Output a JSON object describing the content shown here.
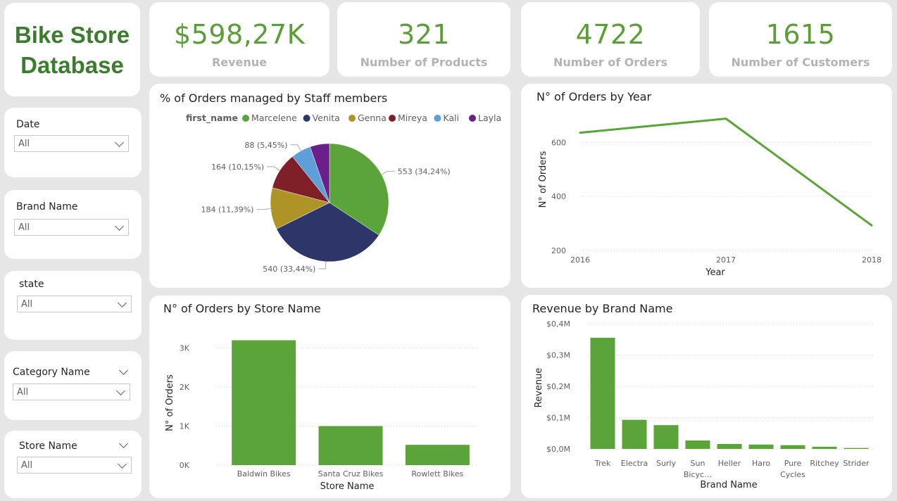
{
  "app": {
    "title_line1": "Bike Store",
    "title_line2": "Database"
  },
  "kpis": [
    {
      "value": "$598,27K",
      "label": "Revenue"
    },
    {
      "value": "321",
      "label": "Number of Products"
    },
    {
      "value": "4722",
      "label": "Number of Orders"
    },
    {
      "value": "1615",
      "label": "Number of Customers"
    }
  ],
  "slicers": {
    "date": {
      "label": "Date",
      "value": "All"
    },
    "brand": {
      "label": "Brand Name",
      "value": "All"
    },
    "state": {
      "label": "state",
      "value": "All"
    },
    "category": {
      "label": "Category Name",
      "value": "All"
    },
    "store": {
      "label": "Store Name",
      "value": "All"
    }
  },
  "colors": {
    "accent": "#5aa43a",
    "title_green": "#3a7d2c",
    "kpi_label": "#b3b3b3",
    "background": "#e6e6e6"
  },
  "chart_data": [
    {
      "type": "pie",
      "title": "% of Orders managed by Staff members",
      "legend_title": "first_name",
      "legend_position": "top",
      "slices": [
        {
          "name": "Marcelene",
          "value": 553,
          "label": "553 (34,24%)",
          "color": "#5aa43a"
        },
        {
          "name": "Venita",
          "value": 540,
          "label": "540 (33,44%)",
          "color": "#2e3568"
        },
        {
          "name": "Genna",
          "value": 184,
          "label": "184 (11,39%)",
          "color": "#ae9326"
        },
        {
          "name": "Mireya",
          "value": 164,
          "label": "164 (10,15%)",
          "color": "#7f1f28"
        },
        {
          "name": "Kali",
          "value": 88,
          "label": "88 (5,45%)",
          "color": "#5e9fd8"
        },
        {
          "name": "Layla",
          "value": 86,
          "label": "",
          "color": "#6b1f8a"
        }
      ]
    },
    {
      "type": "line",
      "title": "N° of Orders by Year",
      "xlabel": "Year",
      "ylabel": "N° of Orders",
      "x": [
        "2016",
        "2017",
        "2018"
      ],
      "values": [
        636,
        688,
        293
      ],
      "ylim": [
        200,
        700
      ],
      "yticks": [
        200,
        400,
        600
      ],
      "grid": true,
      "color": "#5aa43a"
    },
    {
      "type": "bar",
      "title": "N° of Orders by Store Name",
      "xlabel": "Store Name",
      "ylabel": "N° of Orders",
      "categories": [
        "Baldwin Bikes",
        "Santa Cruz Bikes",
        "Rowlett Bikes"
      ],
      "values": [
        3200,
        1000,
        520
      ],
      "ylim": [
        0,
        3300
      ],
      "yticks": [
        {
          "v": 0,
          "t": "0K"
        },
        {
          "v": 1000,
          "t": "1K"
        },
        {
          "v": 2000,
          "t": "2K"
        },
        {
          "v": 3000,
          "t": "3K"
        }
      ],
      "grid": true,
      "color": "#5aa43a"
    },
    {
      "type": "bar",
      "title": "Revenue by Brand Name",
      "xlabel": "Brand Name",
      "ylabel": "Revenue",
      "categories": [
        "Trek",
        "Electra",
        "Surly",
        "Sun Bicyc...",
        "Heller",
        "Haro",
        "Pure Cycles",
        "Ritchey",
        "Strider"
      ],
      "category_lines": [
        [
          "Trek"
        ],
        [
          "Electra"
        ],
        [
          "Surly"
        ],
        [
          "Sun",
          "Bicyc…"
        ],
        [
          "Heller"
        ],
        [
          "Haro"
        ],
        [
          "Pure",
          "Cycles"
        ],
        [
          "Ritchey"
        ],
        [
          "Strider"
        ]
      ],
      "values": [
        0.355,
        0.093,
        0.076,
        0.027,
        0.016,
        0.014,
        0.012,
        0.007,
        0.003
      ],
      "ylim": [
        0,
        0.4
      ],
      "yticks": [
        {
          "v": 0,
          "t": "$0,0M"
        },
        {
          "v": 0.1,
          "t": "$0,1M"
        },
        {
          "v": 0.2,
          "t": "$0,2M"
        },
        {
          "v": 0.3,
          "t": "$0,3M"
        },
        {
          "v": 0.4,
          "t": "$0,4M"
        }
      ],
      "grid": true,
      "color": "#5aa43a"
    }
  ]
}
